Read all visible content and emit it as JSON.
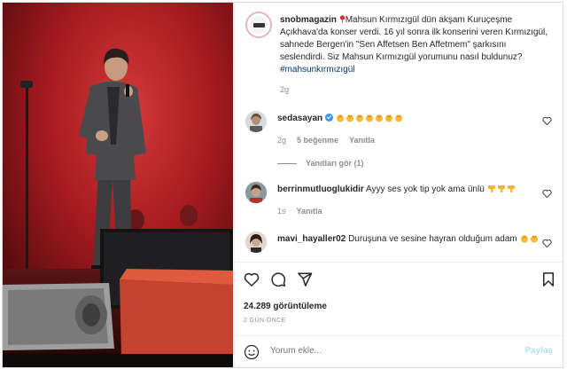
{
  "post": {
    "username": "snobmagazin",
    "caption": "Mahsun Kırmızıgül dün akşam Kuruçeşme Açıkhava'da konser verdi. 16 yıl sonra ilk konserini veren Kırmızıgül, sahnede Bergen'in \"Sen Affetsen Ben Affetmem\" şarkısını seslendirdi. Siz Mahsun Kırmızıgül yorumunu nasıl buldunuz?",
    "hashtag": "#mahsunkırmızıgül",
    "time": "2g",
    "views": "24.289 görüntüleme",
    "date": "2 GÜN ÖNCE"
  },
  "comments": [
    {
      "username": "sedasayan",
      "verified": true,
      "text": "",
      "emoji_count": 7,
      "emoji": "clapping-hands",
      "time": "2g",
      "likes": "5 beğenme",
      "reply": "Yanıtla",
      "view_replies": "Yanıtları gör (1)"
    },
    {
      "username": "berrinmutluoglukidir",
      "text": "Ayyy ses yok tip yok ama ünlü",
      "emoji_count": 3,
      "emoji": "thumbs-down",
      "time": "1s",
      "reply": "Yanıtla"
    },
    {
      "username": "mavi_hayaller02",
      "text": "Duruşuna ve sesine hayran olduğum adam",
      "emoji_count": 2,
      "emoji": "clapping-hands"
    }
  ],
  "comment_input": {
    "placeholder": "Yorum ekle...",
    "post_label": "Paylaş"
  },
  "colors": {
    "link": "#00376b",
    "verified": "#3897f0",
    "muted": "#8e8e8e",
    "post_disabled": "#b2dffc"
  }
}
